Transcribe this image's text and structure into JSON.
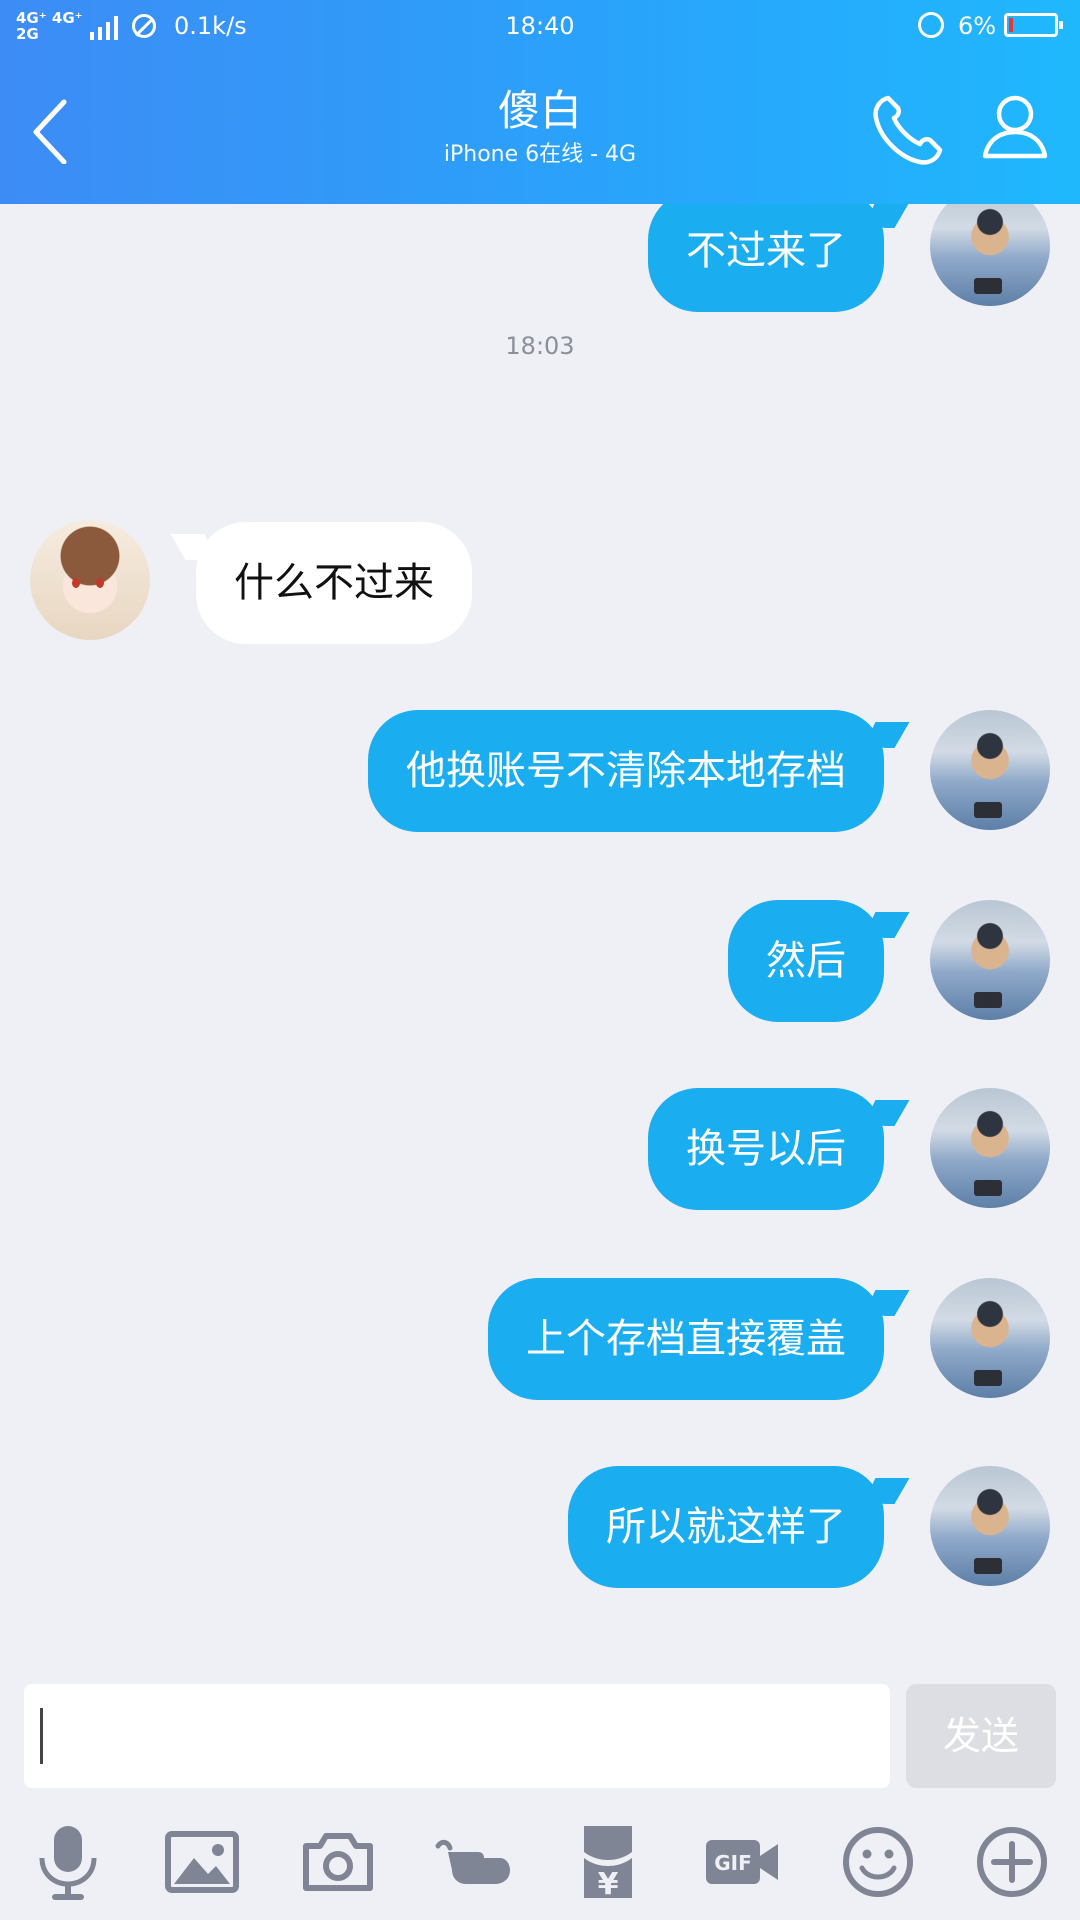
{
  "status_bar": {
    "network": "4G⁺ 4G⁺\n2G",
    "speed": "0.1k/s",
    "time": "18:40",
    "battery": "6%"
  },
  "header": {
    "title": "傻白",
    "subtitle": "iPhone 6在线 - 4G"
  },
  "chat": {
    "timestamp": "18:03",
    "messages": [
      {
        "sender": "me",
        "text": "不过来了"
      },
      {
        "sender": "friend",
        "text": "什么不过来"
      },
      {
        "sender": "me",
        "text": "他换账号不清除本地存档"
      },
      {
        "sender": "me",
        "text": "然后"
      },
      {
        "sender": "me",
        "text": "换号以后"
      },
      {
        "sender": "me",
        "text": "上个存档直接覆盖"
      },
      {
        "sender": "me",
        "text": "所以就这样了"
      }
    ]
  },
  "input": {
    "value": "",
    "send_label": "发送"
  },
  "toolbar": {
    "icons": [
      "microphone-icon",
      "image-icon",
      "camera-icon",
      "poke-hand-icon",
      "red-packet-icon",
      "gif-icon",
      "emoji-icon",
      "plus-icon"
    ],
    "gif_label": "GIF",
    "packet_symbol": "¥"
  },
  "colors": {
    "header_start": "#3d8cf5",
    "header_end": "#1fb8fd",
    "my_bubble": "#1aadf0",
    "friend_bubble": "#ffffff",
    "background": "#eff0f6",
    "toolbar_icon": "#7f8595"
  }
}
